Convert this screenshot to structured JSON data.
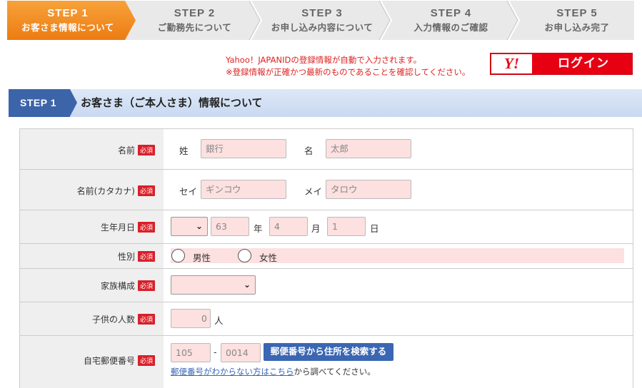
{
  "steps": [
    {
      "num": "STEP 1",
      "label": "お客さま情報について",
      "active": true
    },
    {
      "num": "STEP 2",
      "label": "ご勤務先について",
      "active": false
    },
    {
      "num": "STEP 3",
      "label": "お申し込み内容について",
      "active": false
    },
    {
      "num": "STEP 4",
      "label": "入力情報のご確認",
      "active": false
    },
    {
      "num": "STEP 5",
      "label": "お申し込み完了",
      "active": false
    }
  ],
  "yahoo": {
    "note_line1": "Yahoo！JAPANIDの登録情報が自動で入力されます。",
    "note_line2": "※登録情報が正確かつ最新のものであることを確認してください。",
    "logo_text": "Y!",
    "login_label": "ログイン"
  },
  "section": {
    "tag": "STEP 1",
    "title": "お客さま（ご本人さま）情報について"
  },
  "required_label": "必須",
  "form": {
    "name": {
      "label": "名前",
      "last_label": "姓",
      "last_placeholder": "銀行",
      "first_label": "名",
      "first_placeholder": "太郎"
    },
    "kana": {
      "label": "名前(カタカナ)",
      "last_label": "セイ",
      "last_placeholder": "ギンコウ",
      "first_label": "メイ",
      "first_placeholder": "タロウ"
    },
    "birth": {
      "label": "生年月日",
      "era_value": "",
      "year_placeholder": "63",
      "year_unit": "年",
      "month_placeholder": "4",
      "month_unit": "月",
      "day_placeholder": "1",
      "day_unit": "日"
    },
    "gender": {
      "label": "性別",
      "options": [
        "男性",
        "女性"
      ]
    },
    "family": {
      "label": "家族構成",
      "value": ""
    },
    "children": {
      "label": "子供の人数",
      "placeholder": "0",
      "unit": "人"
    },
    "zip": {
      "label": "自宅郵便番号",
      "part1_placeholder": "105",
      "separator": "-",
      "part2_placeholder": "0014",
      "search_button": "郵便番号から住所を検索する",
      "help_link": "郵便番号がわからない方はこちら",
      "help_suffix": "から調べてください。"
    }
  },
  "colors": {
    "active_step": "#f08a1c",
    "inactive_step": "#e9e9e9",
    "required_badge": "#d8202a",
    "input_bg": "#fde0e0",
    "accent_blue": "#3a66b3",
    "yahoo_red": "#e60012"
  }
}
